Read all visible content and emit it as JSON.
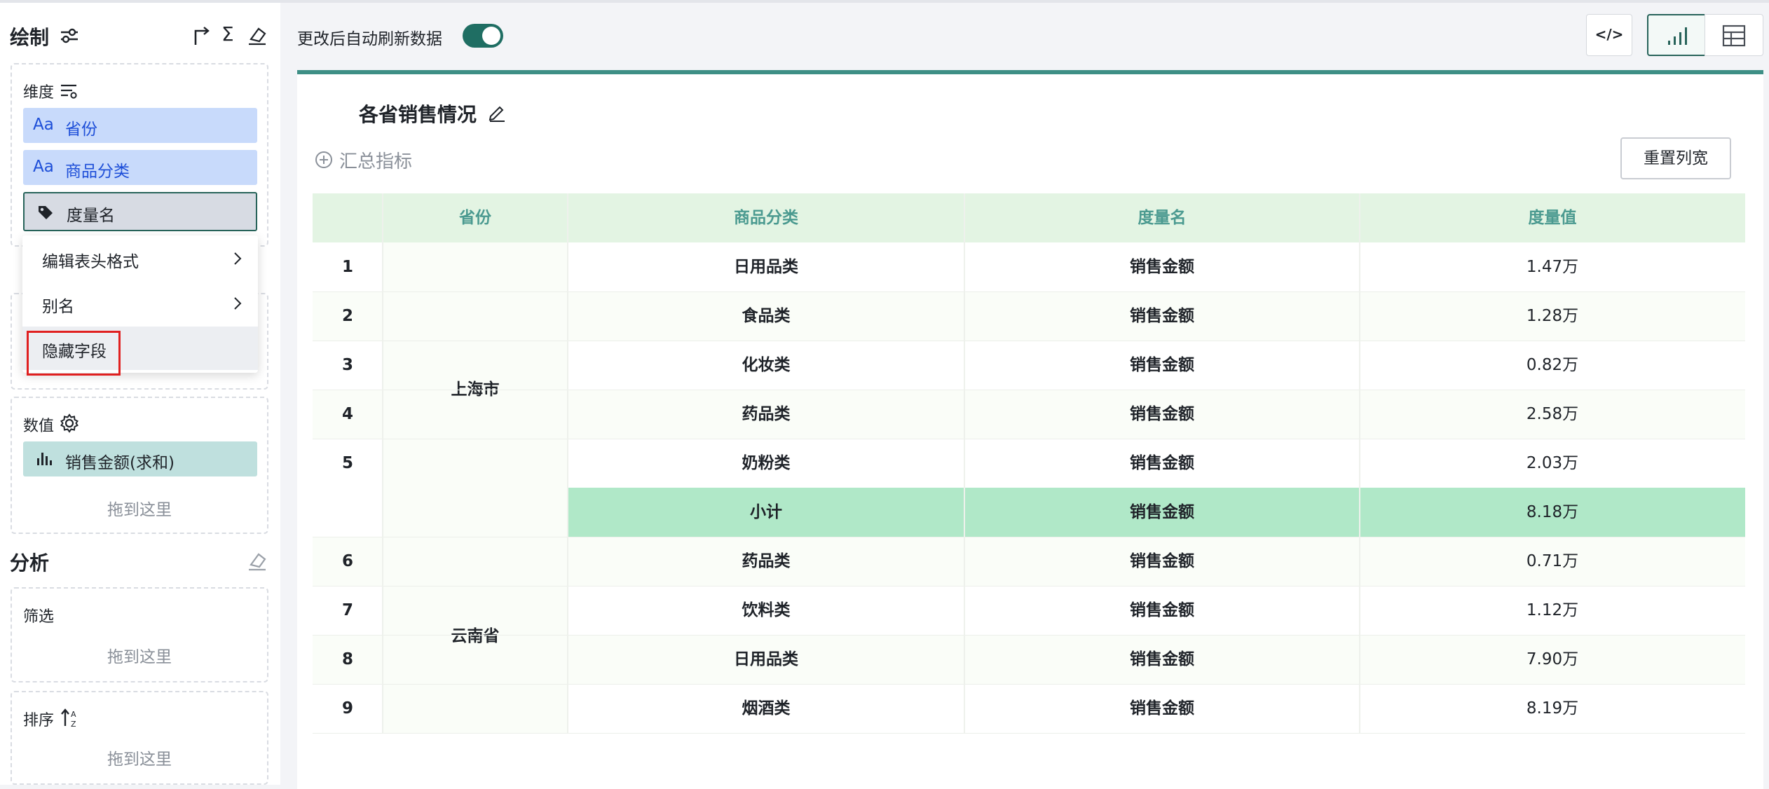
{
  "panel": {
    "title": "绘制",
    "dimension": {
      "label": "维度",
      "items": [
        {
          "prefix": "Aa",
          "label": "省份"
        },
        {
          "prefix": "Aa",
          "label": "商品分类"
        }
      ],
      "measure_names_chip": "度量名"
    },
    "context_menu": {
      "items": [
        {
          "label": "编辑表头格式",
          "has_submenu": true
        },
        {
          "label": "别名",
          "has_submenu": true
        },
        {
          "label": "隐藏字段",
          "has_submenu": false
        }
      ]
    },
    "values": {
      "label": "数值",
      "chip": "销售金额(求和)",
      "drop_hint": "拖到这里"
    },
    "analysis": {
      "title": "分析",
      "filter": {
        "label": "筛选",
        "drop_hint": "拖到这里"
      },
      "sort": {
        "label": "排序",
        "drop_hint": "拖到这里"
      }
    }
  },
  "toolbar": {
    "auto_refresh_label": "更改后自动刷新数据",
    "auto_refresh_on": true,
    "code_icon_text": "</>"
  },
  "card": {
    "title": "各省销售情况",
    "summary_label": "汇总指标",
    "reset_button": "重置列宽"
  },
  "table": {
    "headers": [
      "",
      "省份",
      "商品分类",
      "度量名",
      "度量值"
    ],
    "groups": [
      {
        "province": "上海市",
        "rows": [
          {
            "index": "1",
            "category": "日用品类",
            "measure": "销售金额",
            "value": "1.47万"
          },
          {
            "index": "2",
            "category": "食品类",
            "measure": "销售金额",
            "value": "1.28万"
          },
          {
            "index": "3",
            "category": "化妆类",
            "measure": "销售金额",
            "value": "0.82万"
          },
          {
            "index": "4",
            "category": "药品类",
            "measure": "销售金额",
            "value": "2.58万"
          },
          {
            "index": "5",
            "category": "奶粉类",
            "measure": "销售金额",
            "value": "2.03万"
          }
        ],
        "subtotal": {
          "label": "小计",
          "measure": "销售金额",
          "value": "8.18万"
        }
      },
      {
        "province": "云南省",
        "rows": [
          {
            "index": "6",
            "category": "药品类",
            "measure": "销售金额",
            "value": "0.71万"
          },
          {
            "index": "7",
            "category": "饮料类",
            "measure": "销售金额",
            "value": "1.12万"
          },
          {
            "index": "8",
            "category": "日用品类",
            "measure": "销售金额",
            "value": "7.90万"
          },
          {
            "index": "9",
            "category": "烟酒类",
            "measure": "销售金额",
            "value": "8.19万"
          }
        ]
      }
    ]
  },
  "colors": {
    "accent": "#1f6e63",
    "header_bg": "#e3f4e3",
    "header_text": "#4b9a90",
    "subtotal_bg": "#b0e8c8",
    "dimension_chip": "#c8dafb",
    "value_chip": "#bfe0de",
    "highlight_border": "#e02020"
  }
}
